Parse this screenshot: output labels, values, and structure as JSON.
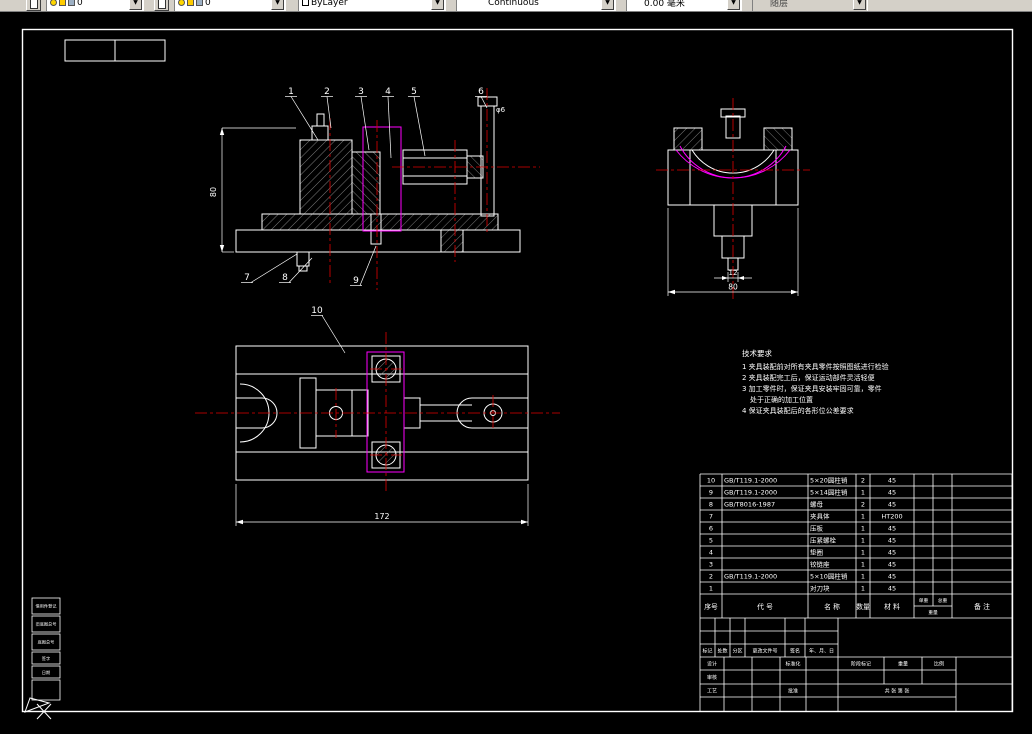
{
  "toolbar": {
    "layer_value": "0",
    "layer2_value": "0",
    "color_value": "ByLayer",
    "linetype_value": "Continuous",
    "lineweight_value": "0.00 毫米",
    "plotstyle_value": "随层",
    "arrow_glyph": "▼"
  },
  "drawing": {
    "callouts": [
      "1",
      "2",
      "3",
      "4",
      "5",
      "6",
      "7",
      "8",
      "9",
      "10"
    ],
    "dims": {
      "front_height": "80",
      "side_step": "12",
      "side_width": "80",
      "plan_length": "172",
      "thread": "φ6"
    },
    "notes": {
      "title": "技术要求",
      "l1": "1 夹具装配前对所有夹具零件按照图纸进行检验",
      "l2": "2 夹具装配完工后，保证运动部件灵活轻便",
      "l3": "3 加工零件时，保证夹具安装牢固可靠，零件",
      "l3b": "处于正确的加工位置",
      "l4": "4 保证夹具装配后的各形位公差要求"
    }
  },
  "parts": {
    "header": {
      "no": "序号",
      "code": "代 号",
      "name": "名 称",
      "qty": "数量",
      "material": "材 料",
      "w1": "单重",
      "w2": "总重",
      "w": "重量",
      "remark": "备 注"
    },
    "rows": [
      {
        "no": "10",
        "code": "GB/T119.1-2000",
        "name": "5×20圆柱销",
        "qty": "2",
        "material": "45"
      },
      {
        "no": "9",
        "code": "GB/T119.1-2000",
        "name": "5×14圆柱销",
        "qty": "1",
        "material": "45"
      },
      {
        "no": "8",
        "code": "GB/T8016-1987",
        "name": "螺母",
        "qty": "2",
        "material": "45"
      },
      {
        "no": "7",
        "code": "",
        "name": "夹具体",
        "qty": "1",
        "material": "HT200"
      },
      {
        "no": "6",
        "code": "",
        "name": "压板",
        "qty": "1",
        "material": "45"
      },
      {
        "no": "5",
        "code": "",
        "name": "压紧螺栓",
        "qty": "1",
        "material": "45"
      },
      {
        "no": "4",
        "code": "",
        "name": "垫圈",
        "qty": "1",
        "material": "45"
      },
      {
        "no": "3",
        "code": "",
        "name": "铰链座",
        "qty": "1",
        "material": "45"
      },
      {
        "no": "2",
        "code": "GB/T119.1-2000",
        "name": "5×10圆柱销",
        "qty": "1",
        "material": "45"
      },
      {
        "no": "1",
        "code": "",
        "name": "对刀块",
        "qty": "1",
        "material": "45"
      }
    ]
  },
  "titleblock": {
    "mark": "标记",
    "count": "处数",
    "zone": "分区",
    "file": "更改文件号",
    "sign": "签名",
    "date": "年、月、日",
    "design": "设计",
    "standard": "标准化",
    "stage": "阶段标记",
    "weight": "重量",
    "scale": "比例",
    "audit": "审核",
    "process": "工艺",
    "approve": "批准",
    "sheets": "共 张 第 张"
  },
  "margin": {
    "b1": "借用件登记",
    "b2": "旧底图总号",
    "b3": "底图总号",
    "b4": "签字",
    "b5": "日期"
  },
  "colors": {
    "line": "#ffffff",
    "workpiece": "#ff00ff",
    "centerline": "#e00000",
    "toolbar_bg": "#d4d0c8"
  }
}
